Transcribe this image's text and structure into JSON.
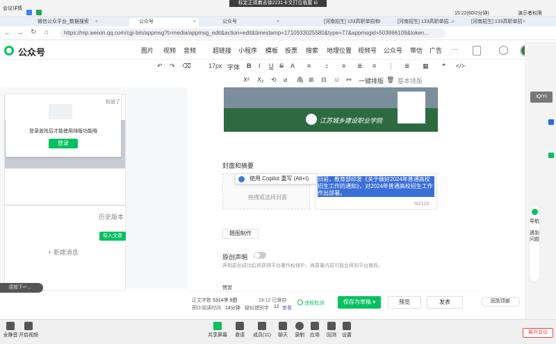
{
  "meeting": {
    "left_label": "会议详情",
    "center_title": "标定正观着去徐2231卡文打位临置 ⊟",
    "right_time": "15:22(60/2分钟)",
    "right_label": "演示者权限"
  },
  "tabs": [
    {
      "label": "微信公众平台_数据搜索"
    },
    {
      "label": "公众号"
    },
    {
      "label": "公众号"
    },
    {
      "label": "[河南招生] 133高职单招和"
    },
    {
      "label": "[河南招生] 133高职单招…"
    },
    {
      "label": "[河南招生] 133高职单招"
    }
  ],
  "address": {
    "url": "https://mp.weixin.qq.com/cgi-bin/appmsg?t=media/appmsg_edit&action=edit&timestamp=1710933025580&type=77&appmsgid=503866109&token..."
  },
  "topnav": {
    "logo": "公众号",
    "items": [
      "图片",
      "视频",
      "音频",
      "超链接",
      "小程序",
      "模板",
      "投票",
      "搜索",
      "地理位置",
      "视频号",
      "公众号",
      "带信",
      "广告",
      "···"
    ]
  },
  "toolbar1": [
    "↶",
    "↷",
    "⌫",
    "17px",
    "字体",
    "B",
    "I",
    "U",
    "S",
    "A",
    "≡",
    "↕",
    "≡",
    "≣",
    "≡",
    "⋮",
    "≣",
    "▦",
    "❝",
    "</>"
  ],
  "toolbar2": [
    "X²",
    "X₂",
    "⟲",
    "⌀",
    "🖇",
    "⊞",
    "⊟",
    "☺",
    "⚯",
    "一键排版",
    "🗑",
    "基本排版"
  ],
  "left": {
    "known": "知道了",
    "login_msg": "登录盖阵后才能使用排版功能哦",
    "login_btn": "登录",
    "new_msg": "+ 新建消息",
    "history": "历史版本",
    "import": "导入文章",
    "bottom_pill": "请按下↵..."
  },
  "banner": {
    "school": "江苏城乡建设职业学院"
  },
  "cover": {
    "section_title": "封面和摘要",
    "placeholder": "拖拽或选择封面",
    "copilot": "使用 Copilot 重写 (Alt+I)",
    "summary": "日前，教育部印发《关于做好2024年普通高校招生工作的通知》，对2024年普通高校招生工作作出部署。",
    "count": "50/120",
    "title_btn": "题图制作"
  },
  "original": {
    "label": "原创声明",
    "desc": "声明原创成功后将获得平台著作权保护，再质量内容可能会得到平台推荐。"
  },
  "reward": {
    "label": "赞赏"
  },
  "bottom": {
    "words_label": "正文字数",
    "words": "5314字 9图",
    "time_label": "预计阅读时间",
    "time": "14分钟",
    "saved": "19:12 已保存",
    "ai_label": "疑似错别字",
    "ai_count": "12",
    "check": "查看",
    "detect": "违规检测",
    "save": "保存为草稿",
    "preview": "预览",
    "publish": "发表",
    "back_top": "回到顶部"
  },
  "right": {
    "iqiyi": "iQIYI",
    "guide": "导航",
    "meet": "遇到问题"
  },
  "taskbar": [
    {
      "label": "全静音"
    },
    {
      "label": "开启视频"
    },
    {
      "label": "共享屏幕"
    },
    {
      "label": "邀请"
    },
    {
      "label": "成员(11)"
    },
    {
      "label": "聊天"
    },
    {
      "label": "录制"
    },
    {
      "label": "应用"
    },
    {
      "label": "回测"
    },
    {
      "label": "设置"
    }
  ],
  "end_meeting": "离开会议"
}
